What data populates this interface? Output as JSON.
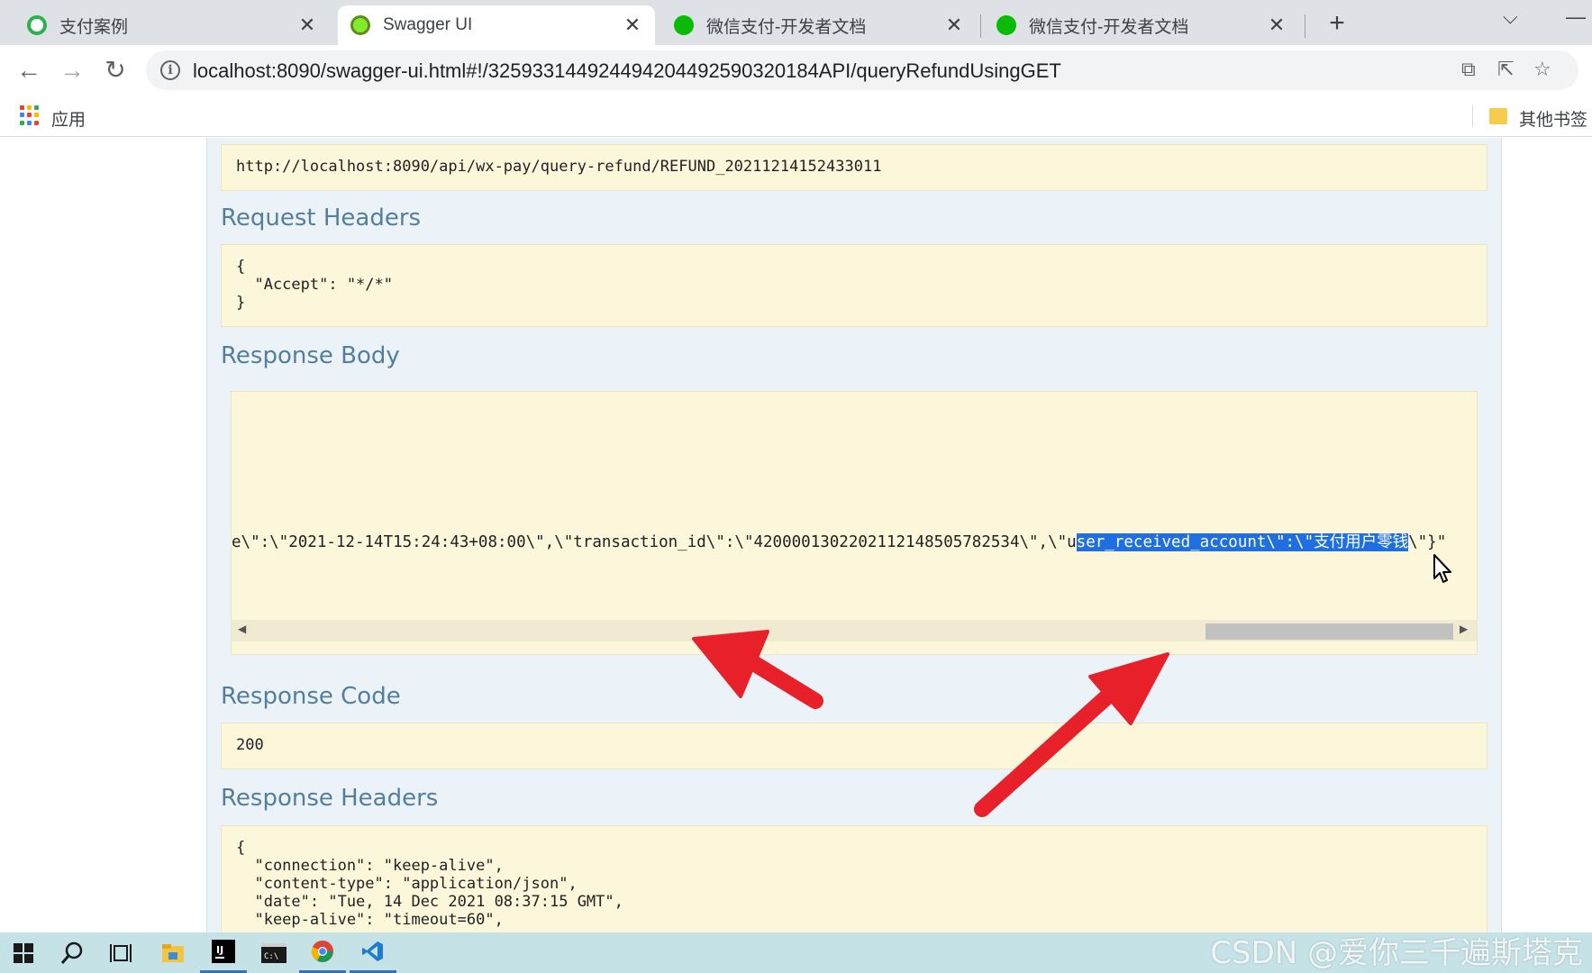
{
  "browser": {
    "tabs": [
      {
        "title": "支付案例",
        "icon": "green-g-logo",
        "active": false
      },
      {
        "title": "Swagger UI",
        "icon": "swagger-icon",
        "active": true
      },
      {
        "title": "微信支付-开发者文档",
        "icon": "wechat-pay-icon",
        "active": false
      },
      {
        "title": "微信支付-开发者文档",
        "icon": "wechat-pay-icon",
        "active": false
      }
    ],
    "url": "localhost:8090/swagger-ui.html#!/32593314492449420449259032018​4API/queryRefundUsingGET",
    "bookmarks": {
      "apps_label": "应用",
      "other_label": "其他书签"
    }
  },
  "swagger": {
    "request_url": "http://localhost:8090/api/wx-pay/query-refund/REFUND_20211214152433011",
    "request_headers_title": "Request Headers",
    "request_headers_lines": [
      "{",
      "  \"Accept\": \"*/*\"",
      "}"
    ],
    "response_body_title": "Response Body",
    "response_body_before": "e\\\":\\\"2021-12-14T15:24:43+08:00\\\",\\\"transaction_id\\\":\\\"4200001302202112148505782534\\\",\\\"u",
    "response_body_selected": "ser_received_account\\\":\\\"支付用户零钱",
    "response_body_after": "\\\"}\"",
    "response_code_title": "Response Code",
    "response_code": "200",
    "response_headers_title": "Response Headers",
    "response_headers_lines": [
      "{",
      "  \"connection\": \"keep-alive\",",
      "  \"content-type\": \"application/json\",",
      "  \"date\": \"Tue, 14 Dec 2021 08:37:15 GMT\",",
      "  \"keep-alive\": \"timeout=60\","
    ]
  },
  "watermark": "CSDN @爱你三千遍斯塔克",
  "colors": {
    "heading": "#547f9c",
    "code_bg": "#fcf6db",
    "panel_bg": "#ebf3f9",
    "annotation_arrow": "#e8202a",
    "selection": "#1f6fe0"
  }
}
